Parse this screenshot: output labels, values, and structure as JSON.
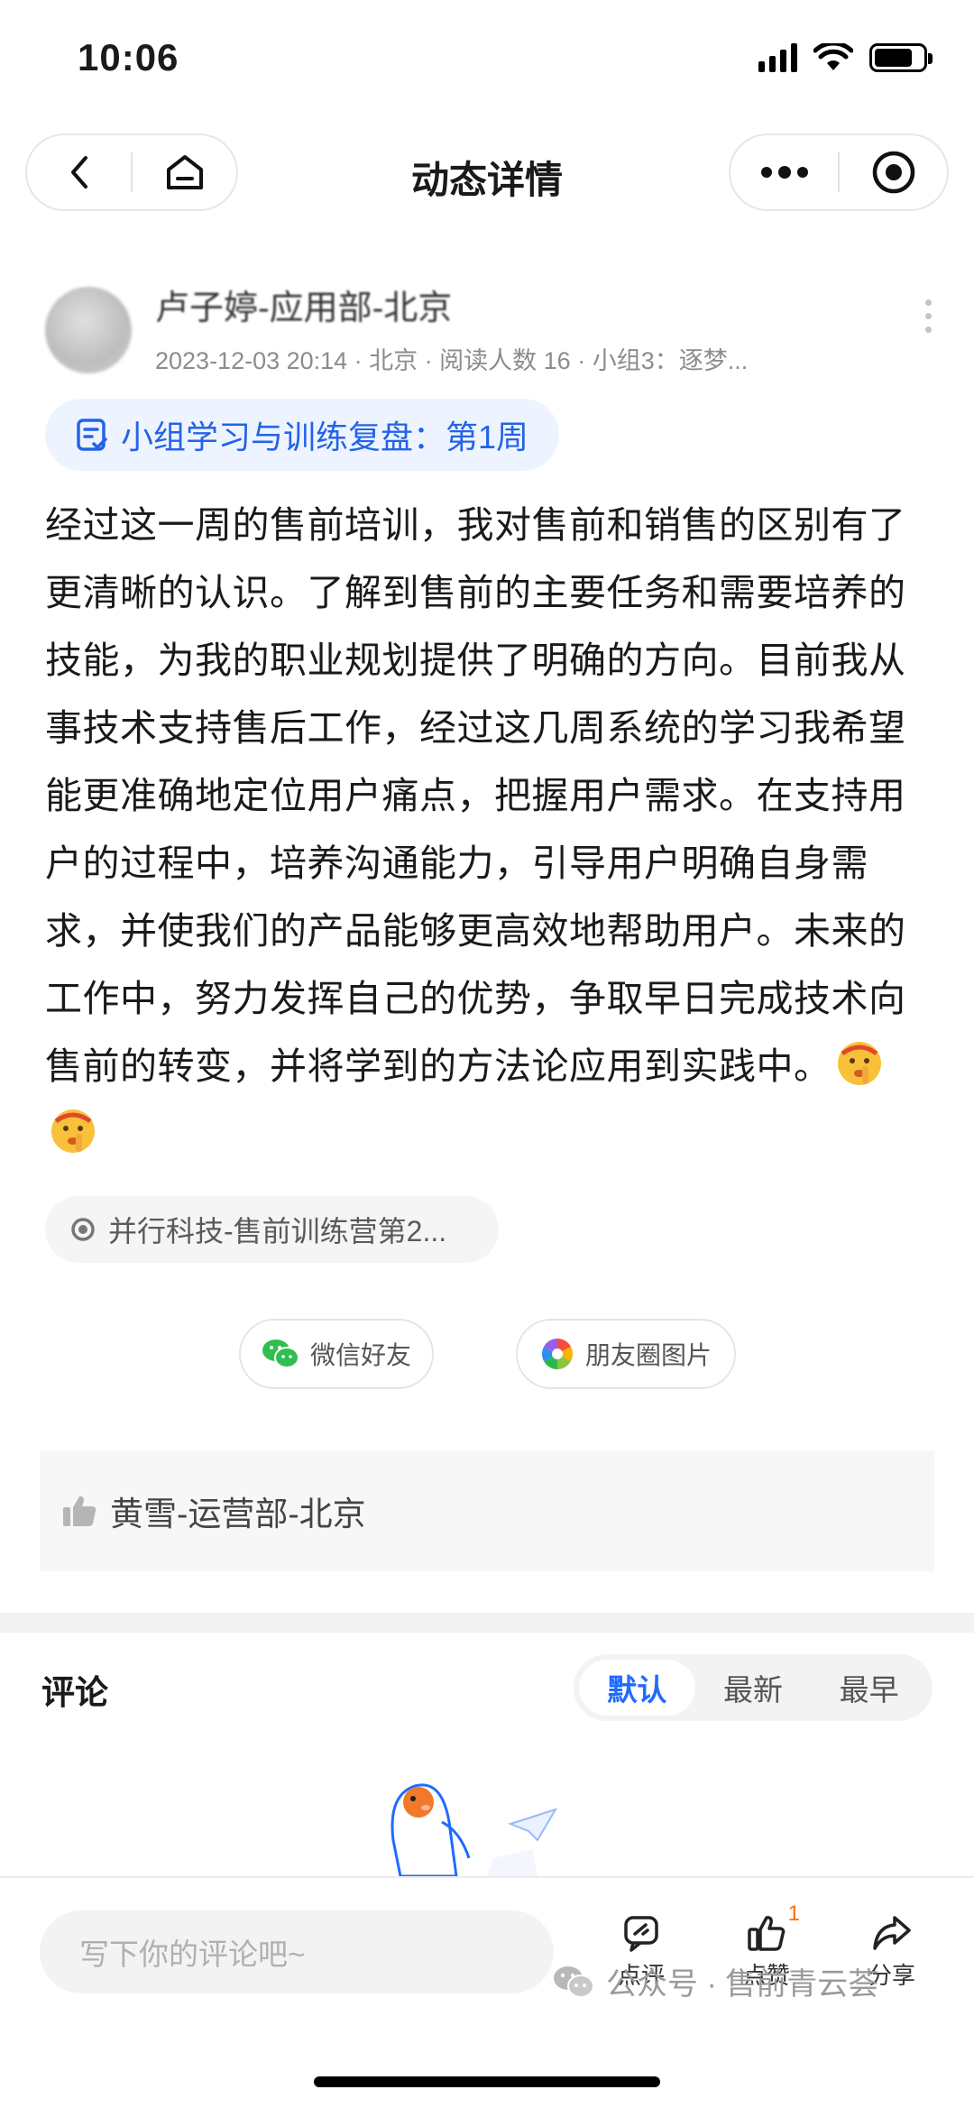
{
  "status_bar": {
    "time": "10:06"
  },
  "nav": {
    "title": "动态详情"
  },
  "post": {
    "author": "卢子婷-应用部-北京",
    "meta": "2023-12-03 20:14 · 北京 · 阅读人数 16 · 小组3：逐梦...",
    "topic": "小组学习与训练复盘：第1周",
    "content": "经过这一周的售前培训，我对售前和销售的区别有了更清晰的认识。了解到售前的主要任务和需要培养的技能，为我的职业规划提供了明确的方向。目前我从事技术支持售后工作，经过这几周系统的学习我希望能更准确地定位用户痛点，把握用户需求。在支持用户的过程中，培养沟通能力，引导用户明确自身需求，并使我们的产品能够更高效地帮助用户。未来的工作中，努力发挥自己的优势，争取早日完成技术向售前的转变，并将学到的方法论应用到实践中。",
    "group": "并行科技-售前训练营第2..."
  },
  "share": {
    "wechat": "微信好友",
    "moments": "朋友圈图片"
  },
  "likes": {
    "names": "黄雪-运营部-北京"
  },
  "comments": {
    "title": "评论",
    "sort_tabs": [
      {
        "label": "默认",
        "active": true
      },
      {
        "label": "最新",
        "active": false
      },
      {
        "label": "最早",
        "active": false
      }
    ]
  },
  "bottom_bar": {
    "placeholder": "写下你的评论吧~",
    "review_label": "点评",
    "like_label": "点赞",
    "like_count": "1",
    "share_label": "分享"
  },
  "watermark": {
    "text": "公众号 · 售前青云荟"
  },
  "colors": {
    "accent": "#1f6bff",
    "topic_bg": "#eef4ff",
    "badge": "#ff6a00"
  }
}
